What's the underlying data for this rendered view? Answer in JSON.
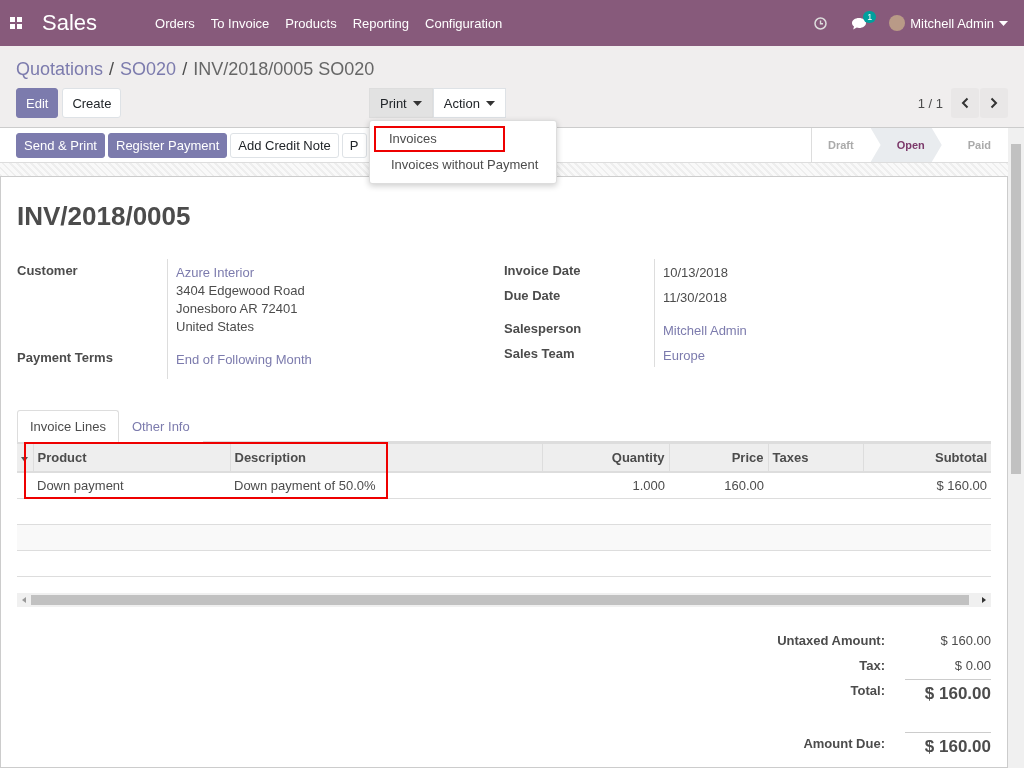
{
  "navbar": {
    "app_title": "Sales",
    "menu": [
      "Orders",
      "To Invoice",
      "Products",
      "Reporting",
      "Configuration"
    ],
    "chat_badge": "1",
    "user": "Mitchell Admin"
  },
  "breadcrumbs": [
    {
      "kind": "link",
      "label": "Quotations"
    },
    {
      "kind": "separator",
      "label": "/"
    },
    {
      "kind": "link",
      "label": "SO020"
    },
    {
      "kind": "separator",
      "label": "/"
    },
    {
      "kind": "current",
      "label": "INV/2018/0005 SO020"
    }
  ],
  "buttons": [
    {
      "label": "Edit",
      "kind": "primary"
    },
    {
      "label": "Create",
      "kind": "secondary"
    }
  ],
  "print_menu": {
    "label": "Print",
    "expanded": true,
    "items": [
      {
        "label": "Invoices",
        "highlighted": true
      },
      {
        "label": "Invoices without Payment",
        "highlighted": false
      }
    ]
  },
  "action_menu": {
    "label": "Action",
    "expanded": false
  },
  "pager": {
    "value": "1 / 1"
  },
  "header_buttons": [
    {
      "label": "Send & Print",
      "kind": "primary"
    },
    {
      "label": "Register Payment",
      "kind": "primary"
    },
    {
      "label": "Add Credit Note",
      "kind": "secondary"
    },
    {
      "label": "P",
      "kind": "secondary"
    }
  ],
  "statusbar": [
    {
      "label": "Draft",
      "selected": false
    },
    {
      "label": "Open",
      "selected": true
    },
    {
      "label": "Paid",
      "selected": false
    }
  ],
  "invoice": {
    "number": "INV/2018/0005",
    "fields_left": [
      {
        "label": "Customer",
        "kind": "link",
        "value": "Azure Interior",
        "extra_lines": [
          "3404 Edgewood Road",
          "Jonesboro AR 72401",
          "United States"
        ]
      },
      {
        "label": "Payment Terms",
        "kind": "link",
        "value": "End of Following Month"
      }
    ],
    "fields_right": [
      {
        "label": "Invoice Date",
        "kind": "plain",
        "value": "10/13/2018"
      },
      {
        "label": "Due Date",
        "kind": "plain",
        "value": "11/30/2018"
      },
      {
        "label": "Salesperson",
        "kind": "link",
        "value": "Mitchell Admin"
      },
      {
        "label": "Sales Team",
        "kind": "link",
        "value": "Europe"
      }
    ]
  },
  "tabs": [
    {
      "label": "Invoice Lines",
      "selected": true
    },
    {
      "label": "Other Info",
      "selected": false
    }
  ],
  "table": {
    "columns": [
      {
        "label": "Product",
        "kind": "text",
        "highlighted": true
      },
      {
        "label": "Description",
        "kind": "text",
        "highlighted": true
      },
      {
        "label": "Quantity",
        "kind": "number",
        "highlighted": false
      },
      {
        "label": "Price",
        "kind": "number",
        "highlighted": false
      },
      {
        "label": "Taxes",
        "kind": "text",
        "highlighted": false
      },
      {
        "label": "Subtotal",
        "kind": "number",
        "highlighted": false
      }
    ],
    "rows": [
      [
        "Down payment",
        "Down payment of 50.0%",
        "1.000",
        "160.00",
        null,
        "$ 160.00"
      ]
    ]
  },
  "totals": [
    {
      "label": "Untaxed Amount:",
      "value": "$ 160.00",
      "kind": "subtotal"
    },
    {
      "label": "Tax:",
      "value": "$ 0.00",
      "kind": "subtotal"
    },
    {
      "label": "Total:",
      "value": "$ 160.00",
      "kind": "total"
    },
    {
      "label": "Amount Due:",
      "value": "$ 160.00",
      "kind": "due"
    }
  ]
}
